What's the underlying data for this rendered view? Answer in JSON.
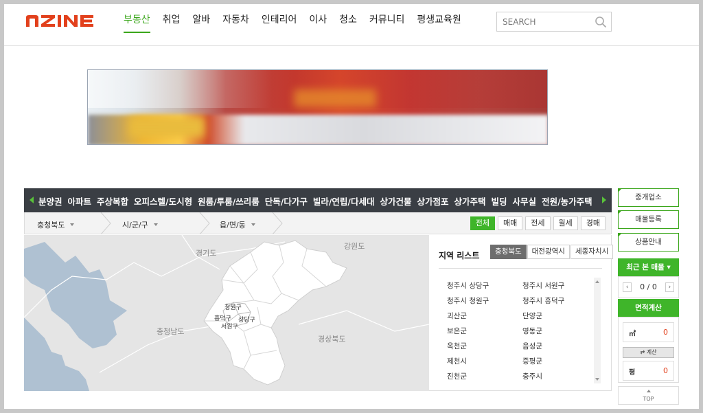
{
  "header": {
    "logo_text": "nZINE",
    "nav": [
      "부동산",
      "취업",
      "알바",
      "자동차",
      "인테리어",
      "이사",
      "청소",
      "커뮤니티",
      "평생교육원"
    ],
    "active_nav": "부동산",
    "search_placeholder": "SEARCH"
  },
  "categories": [
    "분양권",
    "아파트",
    "주상복합",
    "오피스텔/도시형",
    "원룸/투룸/쓰리룸",
    "단독/다가구",
    "빌라/연립/다세대",
    "상가건물",
    "상가점포",
    "상가주택",
    "빌딩",
    "사무실",
    "전원/농가주택"
  ],
  "location": {
    "province": "충청북도",
    "city": "시/군/구",
    "town": "읍/면/동"
  },
  "filters": [
    "전체",
    "매매",
    "전세",
    "월세",
    "경매"
  ],
  "active_filter": "전체",
  "map": {
    "region_labels": [
      "경기도",
      "강원도",
      "충청남도",
      "경상북도"
    ],
    "district_labels": [
      "청원구",
      "흥덕구",
      "상당구",
      "서원구"
    ]
  },
  "region_list": {
    "title": "지역 리스트",
    "tabs": [
      "충청북도",
      "대전광역시",
      "세종자치시"
    ],
    "active_tab": "충청북도",
    "items": [
      "청주시 상당구",
      "청주시 서원구",
      "청주시 청원구",
      "청주시 흥덕구",
      "괴산군",
      "단양군",
      "보은군",
      "영동군",
      "옥천군",
      "음성군",
      "제천시",
      "증평군",
      "진천군",
      "충주시"
    ]
  },
  "sidebar": {
    "agent_label": "중개업소",
    "listing_reg_label": "매물등록",
    "product_info_label": "상품안내",
    "recent_label": "최근 본 매물",
    "recent_count": "0 / 0",
    "area_calc_label": "면적계산",
    "sqm_unit": "㎡",
    "sqm_value": "0",
    "convert_label": "계산",
    "pyeong_unit": "평",
    "pyeong_value": "0",
    "top_label": "TOP"
  },
  "colors": {
    "brand_orange": "#e2401c",
    "accent_green": "#3fb52a",
    "catbar_dark": "#3a3e44"
  }
}
